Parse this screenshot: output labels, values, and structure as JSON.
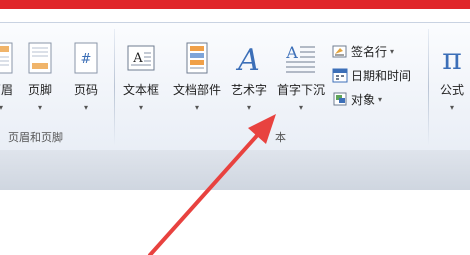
{
  "ribbon": {
    "header_footer_group": {
      "header_label": "页眉",
      "footer_label": "页脚",
      "page_number_label": "页码",
      "group_label": "页眉和页脚"
    },
    "text_group": {
      "textbox_label": "文本框",
      "quickparts_label": "文档部件",
      "wordart_label": "艺术字",
      "dropcap_label": "首字下沉",
      "signature_label": "签名行",
      "datetime_label": "日期和时间",
      "object_label": "对象",
      "group_label_partial": "本"
    },
    "symbols_group": {
      "equation_label": "公式"
    }
  },
  "colors": {
    "accent_red": "#e0262a",
    "arrow_red": "#e8423f",
    "ribbon_bg": "#e9eef6"
  }
}
